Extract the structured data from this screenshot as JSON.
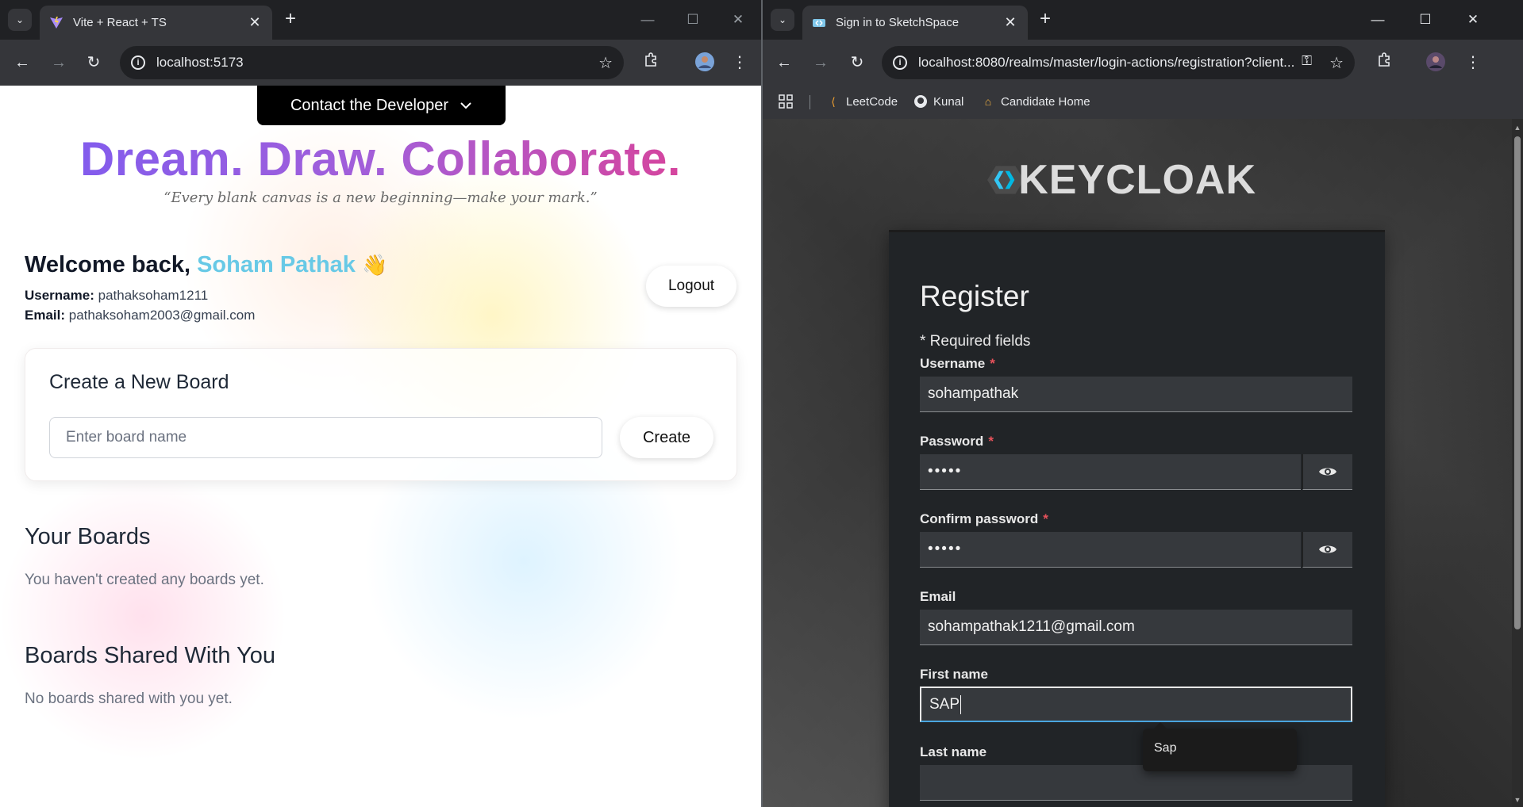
{
  "left_browser": {
    "tab_title": "Vite + React + TS",
    "url": "localhost:5173"
  },
  "right_browser": {
    "tab_title": "Sign in to SketchSpace",
    "url": "localhost:8080/realms/master/login-actions/registration?client...",
    "bookmarks": [
      "LeetCode",
      "Kunal",
      "Candidate Home"
    ]
  },
  "app": {
    "contact_label": "Contact the Developer",
    "hero_title": "Dream. Draw. Collaborate.",
    "quote": "“Every blank canvas is a new beginning—make your mark.”",
    "welcome_prefix": "Welcome back,",
    "user_name": "Soham Pathak",
    "wave_emoji": "👋",
    "username_label": "Username:",
    "username_value": "pathaksoham1211",
    "email_label": "Email:",
    "email_value": "pathaksoham2003@gmail.com",
    "logout_label": "Logout",
    "create_card_title": "Create a New Board",
    "board_input_placeholder": "Enter board name",
    "create_label": "Create",
    "your_boards_title": "Your Boards",
    "your_boards_empty": "You haven't created any boards yet.",
    "shared_title": "Boards Shared With You",
    "shared_empty": "No boards shared with you yet."
  },
  "keycloak": {
    "logo_text": "KEYCLOAK",
    "title": "Register",
    "required_note": "* Required fields",
    "fields": {
      "username_label": "Username",
      "username_value": "sohampathak",
      "password_label": "Password",
      "password_value": "•••••",
      "confirm_label": "Confirm password",
      "confirm_value": "•••••",
      "email_label": "Email",
      "email_value": "sohampathak1211@gmail.com",
      "firstname_label": "First name",
      "firstname_value": "SAP",
      "lastname_label": "Last name",
      "lastname_value": ""
    },
    "autocomplete_suggestion": "Sap",
    "required_marker": "*"
  },
  "colors": {
    "hero_gradient": [
      "#7a5cf2",
      "#e33e8e"
    ],
    "user_name": "#68c9e6",
    "required": "#e8525b",
    "focus": "#4aa6e0"
  }
}
